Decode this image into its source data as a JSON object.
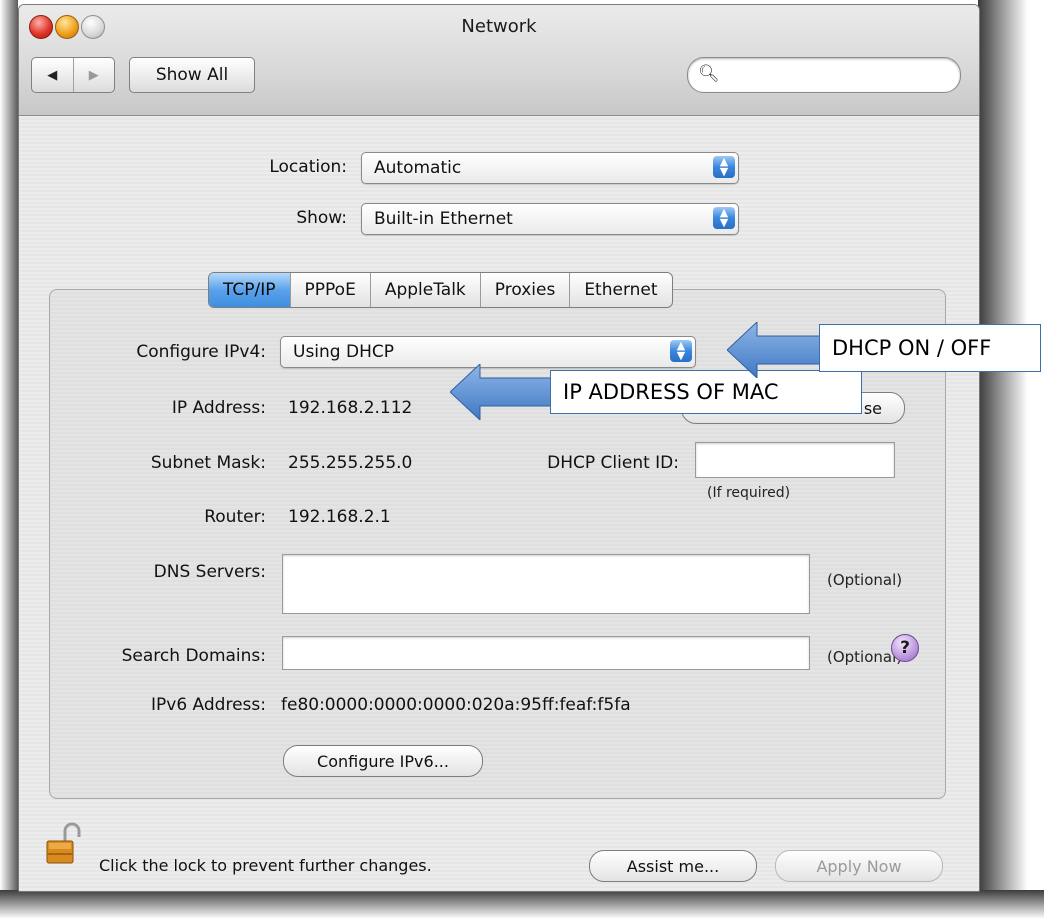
{
  "window": {
    "title": "Network"
  },
  "toolbar": {
    "back": "◀",
    "forward": "▶",
    "show_all": "Show All",
    "search_placeholder": ""
  },
  "location": {
    "label": "Location:",
    "value": "Automatic"
  },
  "show": {
    "label": "Show:",
    "value": "Built-in Ethernet"
  },
  "tabs": [
    "TCP/IP",
    "PPPoE",
    "AppleTalk",
    "Proxies",
    "Ethernet"
  ],
  "tcpip": {
    "configure_label": "Configure IPv4:",
    "configure_value": "Using DHCP",
    "ip_label": "IP Address:",
    "ip_value": "192.168.2.112",
    "renew_button_visible": "se",
    "subnet_label": "Subnet Mask:",
    "subnet_value": "255.255.255.0",
    "client_id_label": "DHCP Client ID:",
    "client_id_value": "",
    "client_id_hint": "(If required)",
    "router_label": "Router:",
    "router_value": "192.168.2.1",
    "dns_label": "DNS Servers:",
    "dns_value": "",
    "dns_hint": "(Optional)",
    "search_label": "Search Domains:",
    "search_value": "",
    "search_hint": "(Optional)",
    "ipv6_label": "IPv6 Address:",
    "ipv6_value": "fe80:0000:0000:0000:020a:95ff:feaf:f5fa",
    "configure_ipv6_button": "Configure IPv6...",
    "help": "?"
  },
  "footer": {
    "lock_text": "Click the lock to prevent further changes.",
    "assist_button": "Assist me...",
    "apply_button": "Apply Now"
  },
  "annotations": {
    "dhcp": "DHCP ON / OFF",
    "ip": "IP ADDRESS OF MAC"
  },
  "colors": {
    "accent": "#3e8ee0",
    "callout_arrow": "#5b8fd0"
  }
}
